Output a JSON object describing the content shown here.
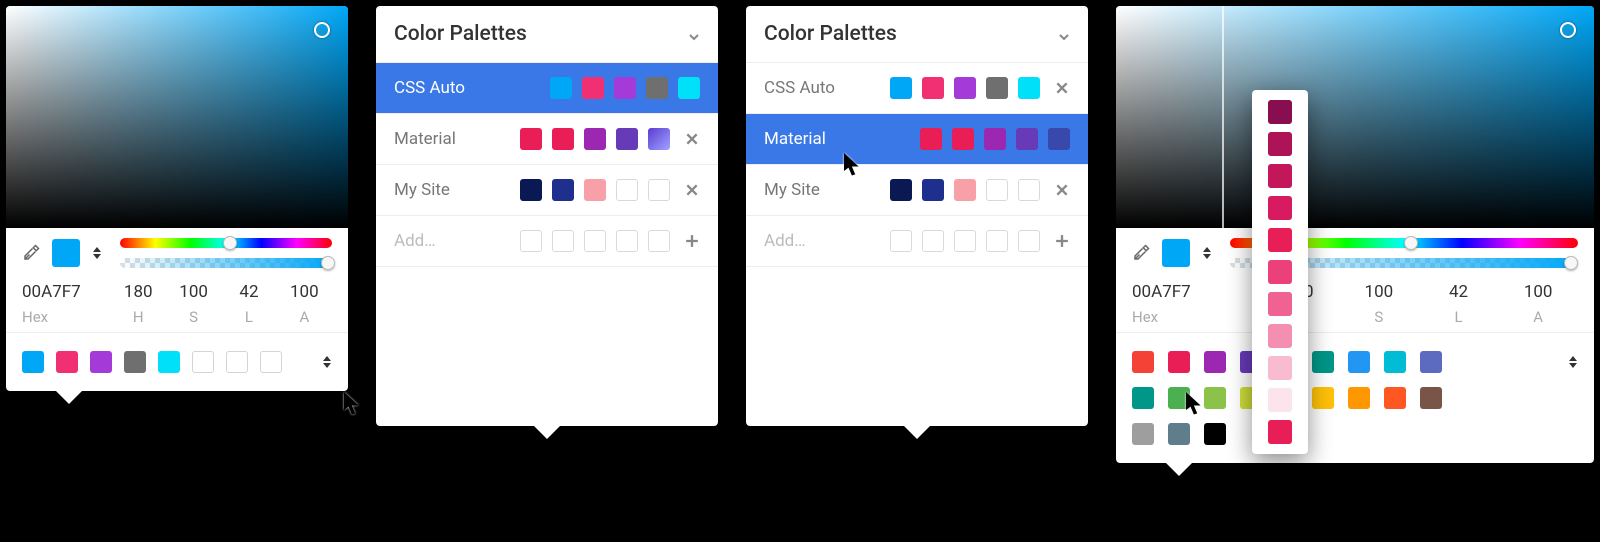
{
  "picker": {
    "hex_value": "00A7F7",
    "hex_label": "Hex",
    "current_color": "#00a7f7",
    "mode": {
      "channels": [
        {
          "val": "180",
          "label": "H"
        },
        {
          "val": "100",
          "label": "S"
        },
        {
          "val": "42",
          "label": "L"
        },
        {
          "val": "100",
          "label": "A"
        }
      ]
    },
    "hue_thumb_pct": 52,
    "alpha_thumb_pct": 98,
    "strip_swatches": [
      "#00a7f7",
      "#f03072",
      "#a43bd9",
      "#6f6f6f",
      "#00e1f9"
    ]
  },
  "palettes_panel": {
    "title": "Color Palettes",
    "add_label": "Add…",
    "rows": [
      {
        "name": "CSS Auto",
        "colors": [
          "#00a7f7",
          "#f03072",
          "#a43bd9",
          "#6f6f6f",
          "#00e1f9"
        ],
        "has_close": true
      },
      {
        "name": "Material",
        "colors": [
          "#e91e56",
          "#e91e56",
          "#9c27b0",
          "#673ab7",
          null
        ],
        "has_close": true,
        "last_is_grad": true
      },
      {
        "name": "My Site",
        "colors": [
          "#0a1854",
          "#1e2f8e",
          "#f7a0a8",
          null,
          null
        ],
        "has_close": true
      }
    ]
  },
  "panel4_grid": {
    "rows": [
      [
        "#f44336",
        "#e91e56",
        "#9c27b0",
        "#673ab7",
        "#3f51b5",
        "#009688",
        "#2196f3",
        "#00bcd4",
        "#5c6bc0"
      ],
      [
        "#009688",
        "#4caf50",
        "#8bc34a",
        "#cddc39",
        "#ffeb3b",
        "#ffc107",
        "#ff9800",
        "#ff5722",
        "#795548"
      ],
      [
        "#9e9e9e",
        "#607d8b",
        "#000000"
      ]
    ]
  },
  "material_shades": [
    "#880e4f",
    "#ad1457",
    "#c2185b",
    "#d81b60",
    "#e91e56",
    "#ec407a",
    "#f06292",
    "#f48fb1",
    "#f8bbd0",
    "#fce4ec",
    "#e91e56"
  ]
}
